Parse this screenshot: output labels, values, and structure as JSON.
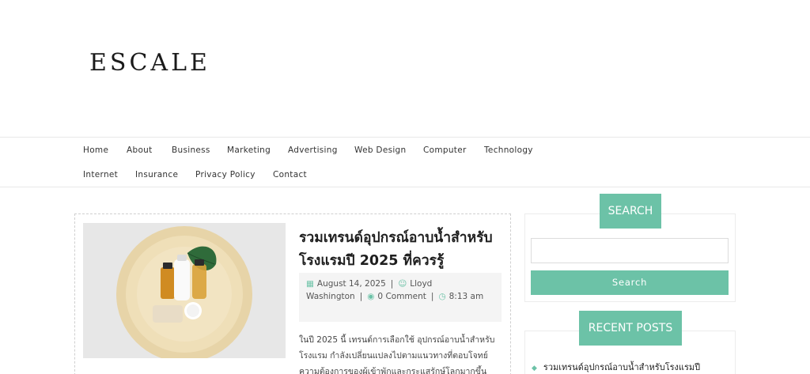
{
  "site": {
    "logo_text": "ESCALE"
  },
  "nav": {
    "items": [
      "Home",
      "About",
      "Business",
      "Marketing",
      "Advertising",
      "Web Design",
      "Computer",
      "Technology",
      "Internet",
      "Insurance",
      "Privacy Policy",
      "Contact"
    ]
  },
  "post": {
    "title": "รวมเทรนด์อุปกรณ์อาบน้ำสำหรับโรงแรมปี 2025 ที่ควรรู้",
    "date": "August 14, 2025",
    "author": "Lloyd Washington",
    "comments": "0 Comment",
    "time": "8:13 am",
    "excerpt": "ในปี 2025 นี้ เทรนด์การเลือกใช้ อุปกรณ์อาบน้ำสำหรับโรงแรม กำลังเปลี่ยนแปลงไปตามแนวทางที่ตอบโจทย์ความต้องการของผู้เข้าพักและกระแสรักษ์โลกมากขึ้น"
  },
  "sidebar": {
    "search": {
      "title": "SEARCH",
      "placeholder": "",
      "button_label": "Search"
    },
    "recent": {
      "title": "RECENT POSTS",
      "items": [
        "รวมเทรนด์อุปกรณ์อาบน้ำสำหรับโรงแรมปี"
      ]
    }
  },
  "colors": {
    "accent": "#6cc2a7"
  },
  "icons": {
    "date": "calendar-icon",
    "author": "user-icon",
    "comments": "comments-icon",
    "time": "clock-icon",
    "bullet": "diamond-icon"
  }
}
